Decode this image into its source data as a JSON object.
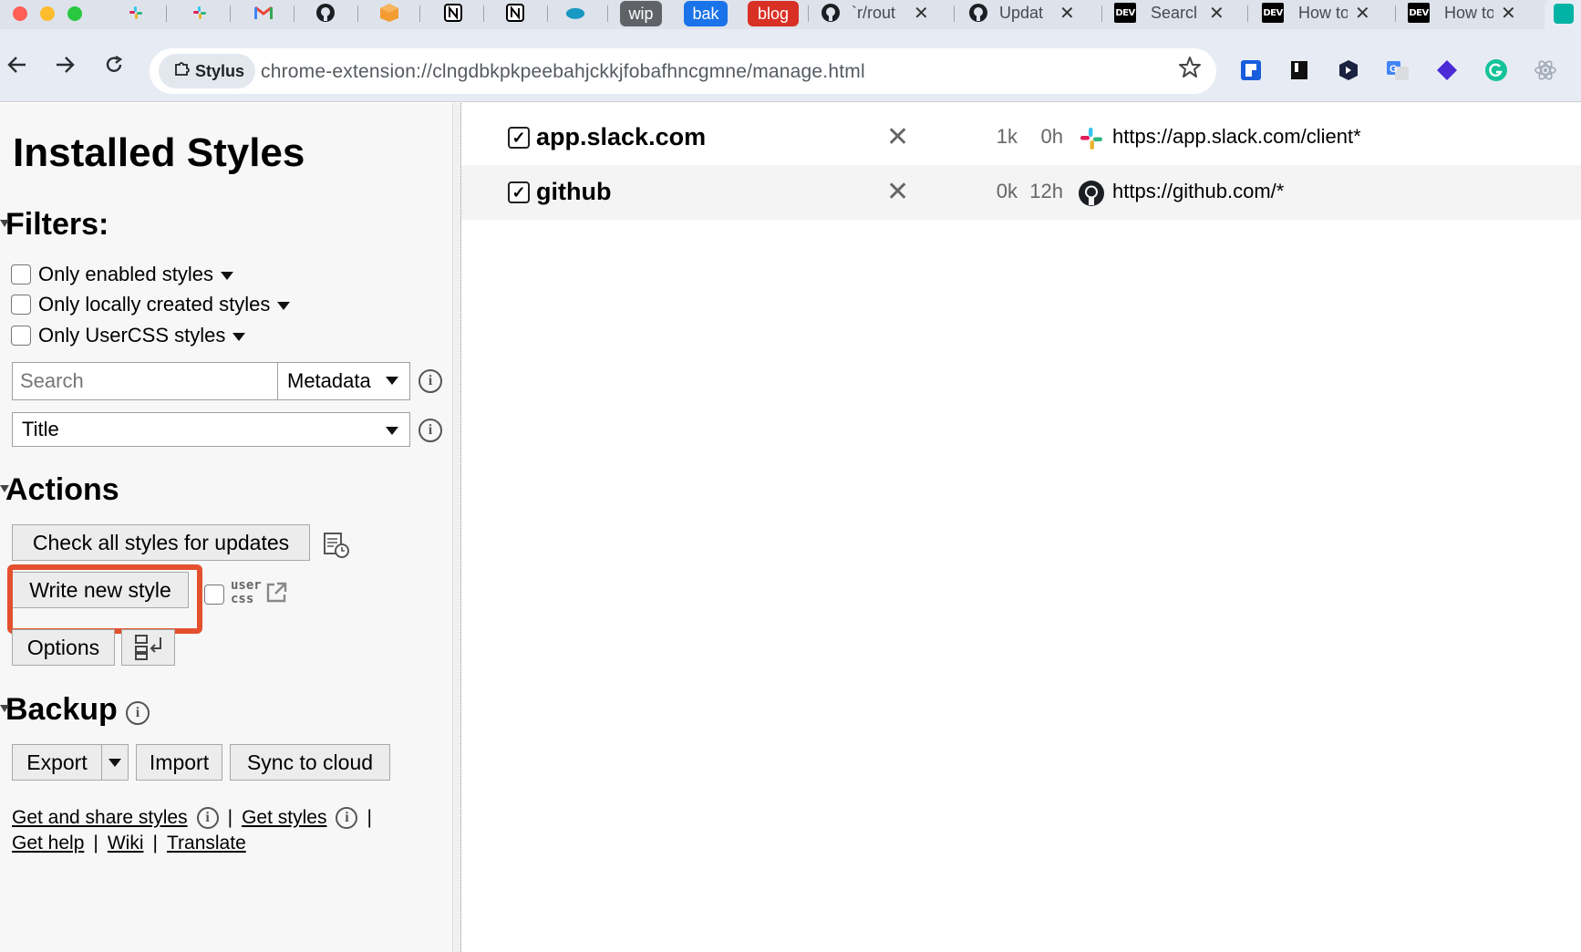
{
  "tabs": {
    "pills": [
      {
        "label": "wip",
        "color": "#5f6368"
      },
      {
        "label": "bak",
        "color": "#1a73e8"
      },
      {
        "label": "blog",
        "color": "#d93025"
      }
    ],
    "titled": [
      {
        "title": "`r/rout",
        "icon": "github-icon"
      },
      {
        "title": "Updat",
        "icon": "github-icon"
      },
      {
        "title": "Searcl",
        "icon": "dev-icon"
      },
      {
        "title": "How to",
        "icon": "dev-icon"
      },
      {
        "title": "How to",
        "icon": "dev-icon"
      }
    ],
    "dev_icon_text": "DEV",
    "close_glyph": "✕"
  },
  "toolbar": {
    "extension_chip": "Stylus",
    "url": "chrome-extension://clngdbkpkpeebahjckkjfobafhncgmne/manage.html"
  },
  "sidebar": {
    "title": "Installed Styles",
    "filters_heading": "Filters:",
    "filters": [
      {
        "label": "Only enabled styles"
      },
      {
        "label": "Only locally created styles"
      },
      {
        "label": "Only UserCSS styles"
      }
    ],
    "search_placeholder": "Search",
    "search_mode": "Metadata",
    "sort_by": "Title",
    "actions_heading": "Actions",
    "check_updates_label": "Check all styles for updates",
    "write_new_style_label": "Write new style",
    "usercss_label_top": "user",
    "usercss_label_bottom": "css",
    "options_label": "Options",
    "backup_heading": "Backup",
    "export_label": "Export",
    "import_label": "Import",
    "sync_label": "Sync to cloud",
    "links": {
      "get_and_share": "Get and share styles",
      "get_styles": "Get styles",
      "get_help": "Get help",
      "wiki": "Wiki",
      "translate": "Translate"
    },
    "info_glyph": "i"
  },
  "styles": [
    {
      "name": "app.slack.com",
      "enabled": true,
      "size": "1k",
      "age": "0h",
      "url": "https://app.slack.com/client*",
      "icon": "slack-icon"
    },
    {
      "name": "github",
      "enabled": true,
      "size": "0k",
      "age": "12h",
      "url": "https://github.com/*",
      "icon": "github-icon"
    }
  ],
  "check_glyph": "✓",
  "delete_glyph": "✕",
  "highlight_color": "#e4502e"
}
